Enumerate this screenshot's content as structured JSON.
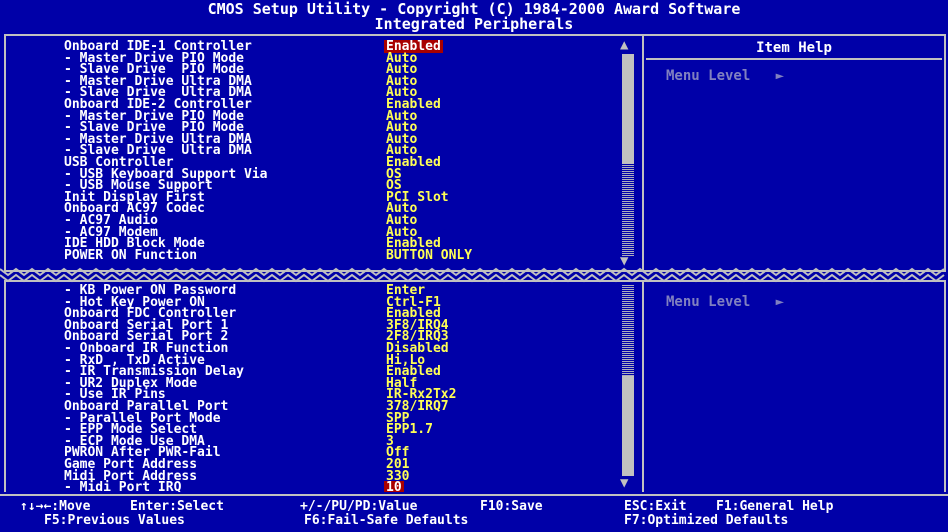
{
  "title": {
    "line1": "CMOS Setup Utility - Copyright (C) 1984-2000 Award Software",
    "line2": "Integrated Peripherals"
  },
  "screen1": {
    "items": [
      {
        "label": "Onboard IDE-1 Controller",
        "value": "Enabled",
        "selected": true
      },
      {
        "label": "- Master Drive PIO Mode",
        "value": "Auto"
      },
      {
        "label": "- Slave Drive  PIO Mode",
        "value": "Auto"
      },
      {
        "label": "- Master Drive Ultra DMA",
        "value": "Auto"
      },
      {
        "label": "- Slave Drive  Ultra DMA",
        "value": "Auto"
      },
      {
        "label": "Onboard IDE-2 Controller",
        "value": "Enabled"
      },
      {
        "label": "- Master Drive PIO Mode",
        "value": "Auto"
      },
      {
        "label": "- Slave Drive  PIO Mode",
        "value": "Auto"
      },
      {
        "label": "- Master Drive Ultra DMA",
        "value": "Auto"
      },
      {
        "label": "- Slave Drive  Ultra DMA",
        "value": "Auto"
      },
      {
        "label": "USB Controller",
        "value": "Enabled"
      },
      {
        "label": "- USB Keyboard Support Via",
        "value": "OS"
      },
      {
        "label": "- USB Mouse Support",
        "value": "OS"
      },
      {
        "label": "Init Display First",
        "value": "PCI Slot"
      },
      {
        "label": "Onboard AC97 Codec",
        "value": "Auto"
      },
      {
        "label": "- AC97 Audio",
        "value": "Auto"
      },
      {
        "label": "- AC97 Modem",
        "value": "Auto"
      },
      {
        "label": "IDE HDD Block Mode",
        "value": "Enabled"
      },
      {
        "label": "POWER ON Function",
        "value": "BUTTON ONLY"
      }
    ],
    "help_title": "Item Help",
    "menu_level": "Menu Level   ►"
  },
  "screen2": {
    "items": [
      {
        "label": "- KB Power ON Password",
        "value": "Enter"
      },
      {
        "label": "- Hot Key Power ON",
        "value": "Ctrl-F1"
      },
      {
        "label": "Onboard FDC Controller",
        "value": "Enabled"
      },
      {
        "label": "Onboard Serial Port 1",
        "value": "3F8/IRQ4"
      },
      {
        "label": "Onboard Serial Port 2",
        "value": "2F8/IRQ3"
      },
      {
        "label": "- Onboard IR Function",
        "value": "Disabled"
      },
      {
        "label": "- RxD , TxD Active",
        "value": "Hi,Lo"
      },
      {
        "label": "- IR Transmission Delay",
        "value": "Enabled"
      },
      {
        "label": "- UR2 Duplex Mode",
        "value": "Half"
      },
      {
        "label": "- Use IR Pins",
        "value": "IR-Rx2Tx2"
      },
      {
        "label": "Onboard Parallel Port",
        "value": "378/IRQ7"
      },
      {
        "label": "- Parallel Port Mode",
        "value": "SPP"
      },
      {
        "label": "- EPP Mode Select",
        "value": "EPP1.7"
      },
      {
        "label": "- ECP Mode Use DMA",
        "value": "3"
      },
      {
        "label": "PWRON After PWR-Fail",
        "value": "Off"
      },
      {
        "label": "Game Port Address",
        "value": "201"
      },
      {
        "label": "Midi Port Address",
        "value": "330"
      },
      {
        "label": "- Midi Port IRQ",
        "value": "10",
        "selected": true
      }
    ],
    "menu_level": "Menu Level   ►"
  },
  "footer": {
    "row1": [
      "↑↓→←:Move",
      "Enter:Select",
      "+/-/PU/PD:Value",
      "F10:Save",
      "ESC:Exit",
      "F1:General Help"
    ],
    "row2": [
      "F5:Previous Values",
      "F6:Fail-Safe Defaults",
      "F7:Optimized Defaults"
    ]
  },
  "colors": {
    "background": "#0000a8",
    "label": "#ffffff",
    "value": "#ffff55",
    "selection": "#a80000",
    "frame": "#c0c0c0"
  }
}
